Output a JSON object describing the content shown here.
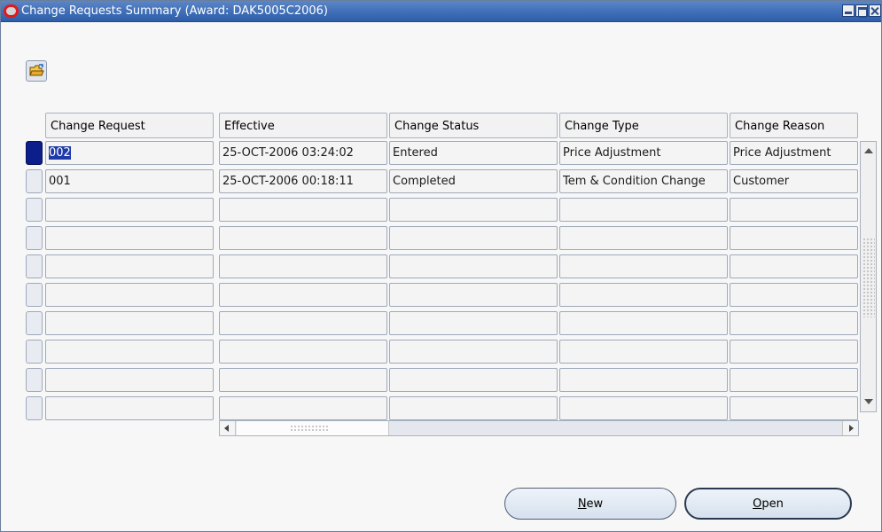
{
  "window": {
    "title": "Change Requests Summary (Award: DAK5005C2006)"
  },
  "toolbar": {
    "open_folder_icon": "folder-open-icon"
  },
  "table": {
    "columns": [
      "Change Request",
      "Effective",
      "Change Status",
      "Change Type",
      "Change Reason"
    ],
    "rows": [
      [
        "002",
        "25-OCT-2006 03:24:02",
        "Entered",
        "Price Adjustment",
        "Price Adjustment"
      ],
      [
        "001",
        "25-OCT-2006 00:18:11",
        "Completed",
        "Tem & Condition Change",
        "Customer"
      ],
      [
        "",
        "",
        "",
        "",
        ""
      ],
      [
        "",
        "",
        "",
        "",
        ""
      ],
      [
        "",
        "",
        "",
        "",
        ""
      ],
      [
        "",
        "",
        "",
        "",
        ""
      ],
      [
        "",
        "",
        "",
        "",
        ""
      ],
      [
        "",
        "",
        "",
        "",
        ""
      ],
      [
        "",
        "",
        "",
        "",
        ""
      ],
      [
        "",
        "",
        "",
        "",
        ""
      ]
    ],
    "selected_row": 0
  },
  "buttons": {
    "new_mnemonic": "N",
    "new_rest": "ew",
    "open_mnemonic": "O",
    "open_rest": "pen"
  },
  "colors": {
    "titlebar": "#3f6fb8",
    "selected_row_marker": "#0c1d8c",
    "oracle_logo": "#e21a1a"
  }
}
